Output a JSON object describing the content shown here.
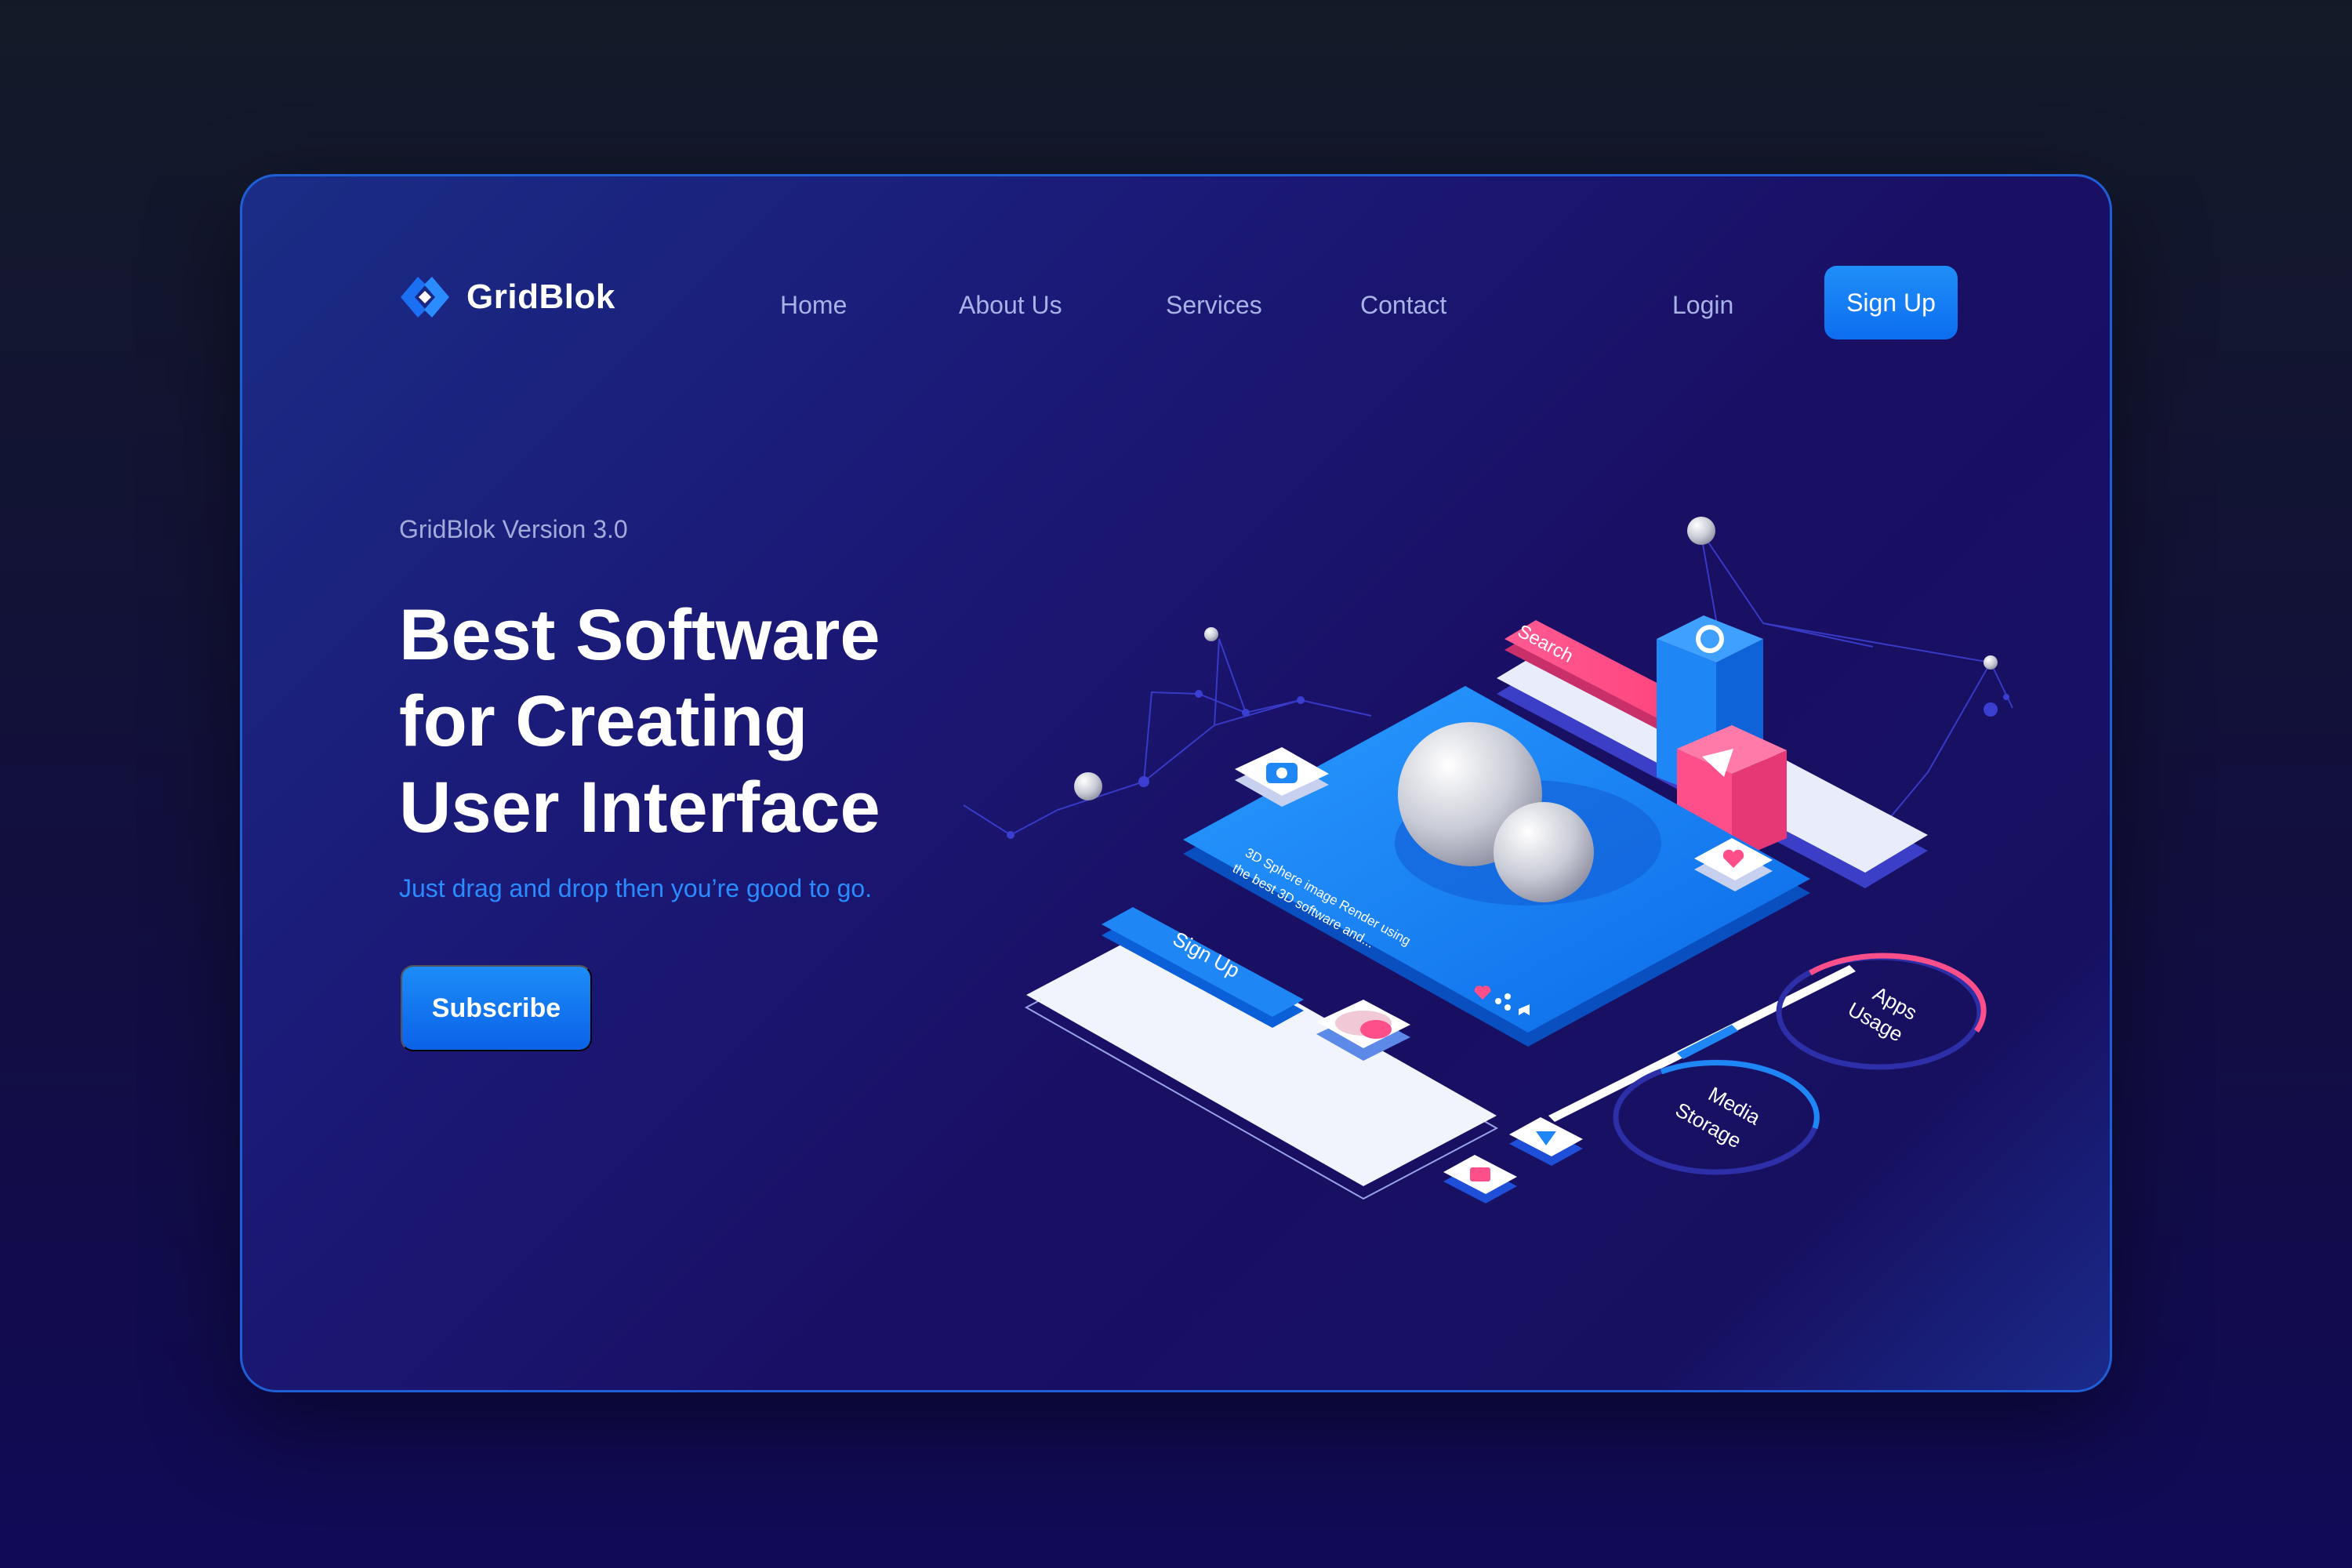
{
  "brand": {
    "name": "GridBlok",
    "logo_icon": "diamond-arrows-icon"
  },
  "nav": {
    "links": [
      "Home",
      "About Us",
      "Services",
      "Contact"
    ],
    "login": "Login",
    "signup": "Sign Up"
  },
  "hero": {
    "version": "GridBlok Version 3.0",
    "headline_lines": [
      "Best Software",
      "for Creating",
      "User Interface"
    ],
    "tagline": "Just drag and drop then you’re good to go.",
    "cta": "Subscribe"
  },
  "illustration": {
    "search_label": "Search",
    "signup_label": "Sign Up",
    "caption_line1": "3D Sphere image Render using",
    "caption_line2": "the best 3D software and...",
    "apps_usage_line1": "Apps",
    "apps_usage_line2": "Usage",
    "media_storage_line1": "Media",
    "media_storage_line2": "Storage"
  },
  "colors": {
    "background": "#131a27",
    "card": "#1b1a78",
    "accent_blue": "#0d6ef0",
    "accent_pink": "#ff4f8b",
    "nav_text": "#a9b2e6",
    "tagline": "#2a8cff"
  }
}
